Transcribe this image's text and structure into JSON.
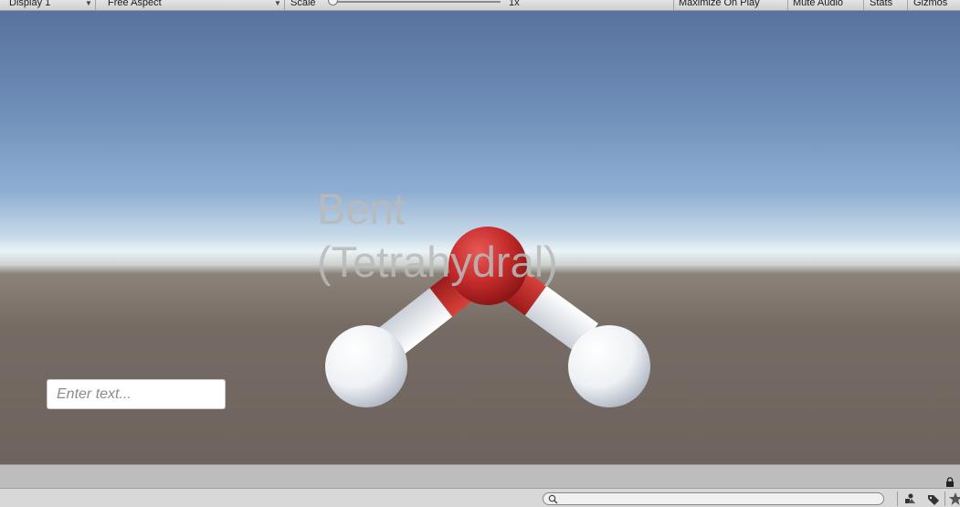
{
  "toolbar": {
    "display": "Display 1",
    "aspect": "Free Aspect",
    "scale_label": "Scale",
    "scale_value": "1x",
    "maximize_on_play": "Maximize On Play",
    "mute_audio": "Mute Audio",
    "stats": "Stats",
    "gizmos": "Gizmos"
  },
  "scene": {
    "geometry_label": "Bent\n(Tetrahydral)",
    "text_input_placeholder": "Enter text...",
    "colors": {
      "oxygen": "#c62b2b",
      "hydrogen": "#f2f4f8"
    }
  },
  "bottom_bar": {
    "icons": [
      "search-icon",
      "lock-icon",
      "layers-icon",
      "tag-icon",
      "star-icon"
    ]
  }
}
